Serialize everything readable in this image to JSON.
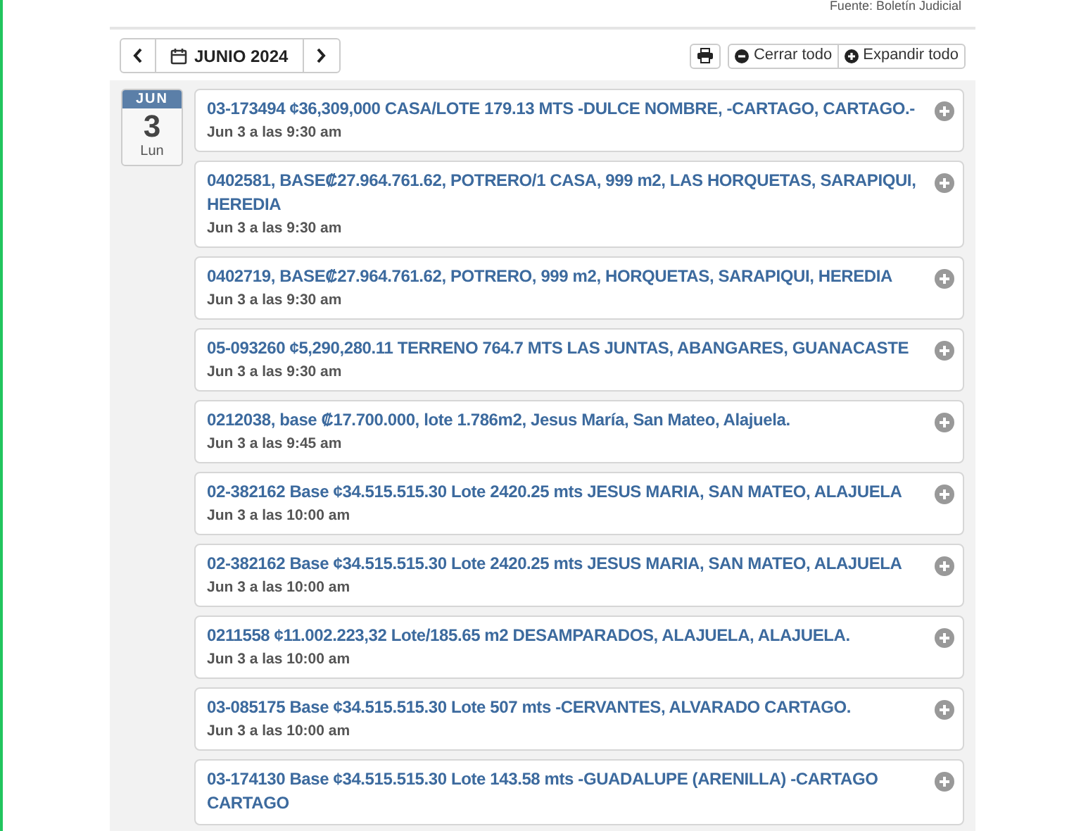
{
  "source_note": "Fuente: Boletín Judicial",
  "toolbar": {
    "month": "JUNIO 2024",
    "buttons": [
      {
        "kind": "collapse",
        "label": "Cerrar todo"
      },
      {
        "kind": "expand",
        "label": "Expandir todo"
      }
    ]
  },
  "day": {
    "month": "JUN",
    "day": "3",
    "weekday": "Lun"
  },
  "events": [
    {
      "title": "03-173494 ¢36,309,000 CASA/LOTE 179.13 MTS -DULCE NOMBRE, -CARTAGO, CARTAGO.-",
      "time": "Jun 3 a las 9:30 am"
    },
    {
      "title": "0402581, BASE₡27.964.761.62, POTRERO/1 CASA, 999 m2, LAS HORQUETAS, SARAPIQUI, HEREDIA",
      "time": "Jun 3 a las 9:30 am"
    },
    {
      "title": "0402719, BASE₡27.964.761.62, POTRERO, 999 m2, HORQUETAS, SARAPIQUI, HEREDIA",
      "time": "Jun 3 a las 9:30 am"
    },
    {
      "title": "05-093260 ¢5,290,280.11 TERRENO 764.7 MTS LAS JUNTAS, ABANGARES,  GUANACASTE",
      "time": "Jun 3 a las 9:30 am"
    },
    {
      "title": "0212038, base ₡17.700.000, lote 1.786m2, Jesus María, San Mateo, Alajuela.",
      "time": "Jun 3 a las 9:45 am"
    },
    {
      "title": "02-382162 Base ¢34.515.515.30 Lote 2420.25 mts  JESUS MARIA, SAN MATEO, ALAJUELA",
      "time": "Jun 3 a las 10:00 am"
    },
    {
      "title": "02-382162 Base ¢34.515.515.30 Lote 2420.25 mts  JESUS MARIA, SAN MATEO, ALAJUELA",
      "time": "Jun 3 a las 10:00 am"
    },
    {
      "title": "0211558 ¢11.002.223,32 Lote/185.65 m2 DESAMPARADOS, ALAJUELA, ALAJUELA.",
      "time": "Jun 3 a las 10:00 am"
    },
    {
      "title": "03-085175 Base ¢34.515.515.30 Lote 507 mts -CERVANTES, ALVARADO CARTAGO.",
      "time": "Jun 3 a las 10:00 am"
    },
    {
      "title": "03-174130 Base ¢34.515.515.30  Lote  143.58 mts -GUADALUPE (ARENILLA) -CARTAGO CARTAGO"
    }
  ]
}
